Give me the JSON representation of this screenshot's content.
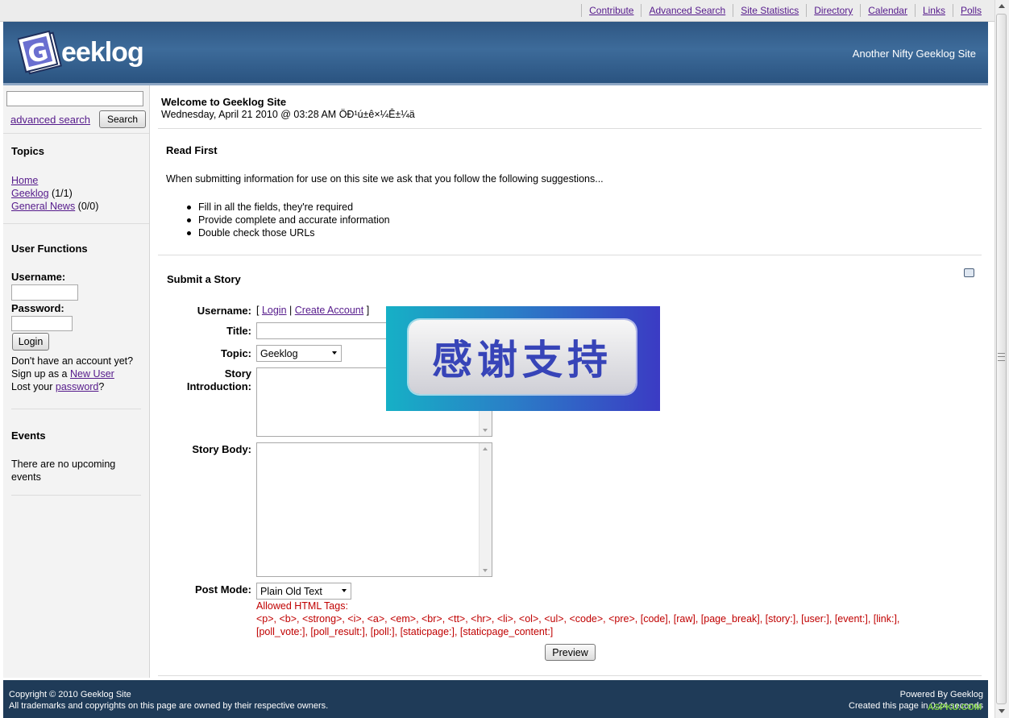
{
  "topnav": [
    "Contribute",
    "Advanced Search",
    "Site Statistics",
    "Directory",
    "Calendar",
    "Links",
    "Polls"
  ],
  "header": {
    "logo_text": "eeklog",
    "logo_letter": "G",
    "slogan": "Another Nifty Geeklog Site"
  },
  "search": {
    "value": "",
    "advanced_link": "advanced search",
    "button": "Search"
  },
  "topics": {
    "title": "Topics",
    "items": [
      {
        "link": "Home",
        "count": ""
      },
      {
        "link": "Geeklog",
        "count": " (1/1)"
      },
      {
        "link": "General News",
        "count": " (0/0)"
      }
    ]
  },
  "user_functions": {
    "title": "User Functions",
    "username_label": "Username:",
    "password_label": "Password:",
    "login_button": "Login",
    "no_account": "Don't have an account yet?",
    "signup_prefix": "Sign up as a ",
    "signup_link": "New User",
    "lost_prefix": "Lost your ",
    "lost_link": "password",
    "lost_suffix": "?"
  },
  "events": {
    "title": "Events",
    "text": "There are no upcoming events"
  },
  "welcome": {
    "title": "Welcome to Geeklog Site",
    "date": "Wednesday, April 21 2010 @ 03:28 AM ÖÐ¹ú±ê×¼Ê±¼ä"
  },
  "read_first": {
    "title": "Read First",
    "intro": "When submitting information for use on this site we ask that you follow the following suggestions...",
    "items": [
      "Fill in all the fields, they're required",
      "Provide complete and accurate information",
      "Double check those URLs"
    ]
  },
  "submit": {
    "title": "Submit a Story",
    "username_label": "Username:",
    "login_bracket_open": "[ ",
    "login_link": "Login",
    "login_sep": " | ",
    "create_link": "Create Account",
    "login_bracket_close": " ]",
    "title_label": "Title:",
    "title_value": "",
    "topic_label": "Topic:",
    "topic_value": "Geeklog",
    "intro_label_1": "Story",
    "intro_label_2": "Introduction:",
    "body_label": "Story Body:",
    "postmode_label": "Post Mode:",
    "postmode_value": "Plain Old Text",
    "allowed_title": "Allowed HTML Tags:",
    "allowed_line1": "<p>, <b>, <strong>, <i>, <a>, <em>, <br>, <tt>, <hr>, <li>, <ol>, <ul>, <code>, <pre>, [code], [raw], [page_break], [story:], [user:], [event:], [link:],",
    "allowed_line2": "[poll_vote:], [poll_result:], [poll:], [staticpage:], [staticpage_content:]",
    "preview_button": "Preview"
  },
  "banner": {
    "text": "感谢支持"
  },
  "footer": {
    "copyright": "Copyright © 2010 Geeklog Site",
    "trademarks": "All trademarks and copyrights on this page are owned by their respective owners.",
    "powered": "Powered By Geeklog",
    "created": "Created this page in 0.24 seconds",
    "watermark": "ASPKU.COM"
  },
  "colors": {
    "header_bg": "#2f5783",
    "footer_bg": "#1f3b58",
    "link": "#551a8b",
    "allowed_tags": "#c00000"
  }
}
